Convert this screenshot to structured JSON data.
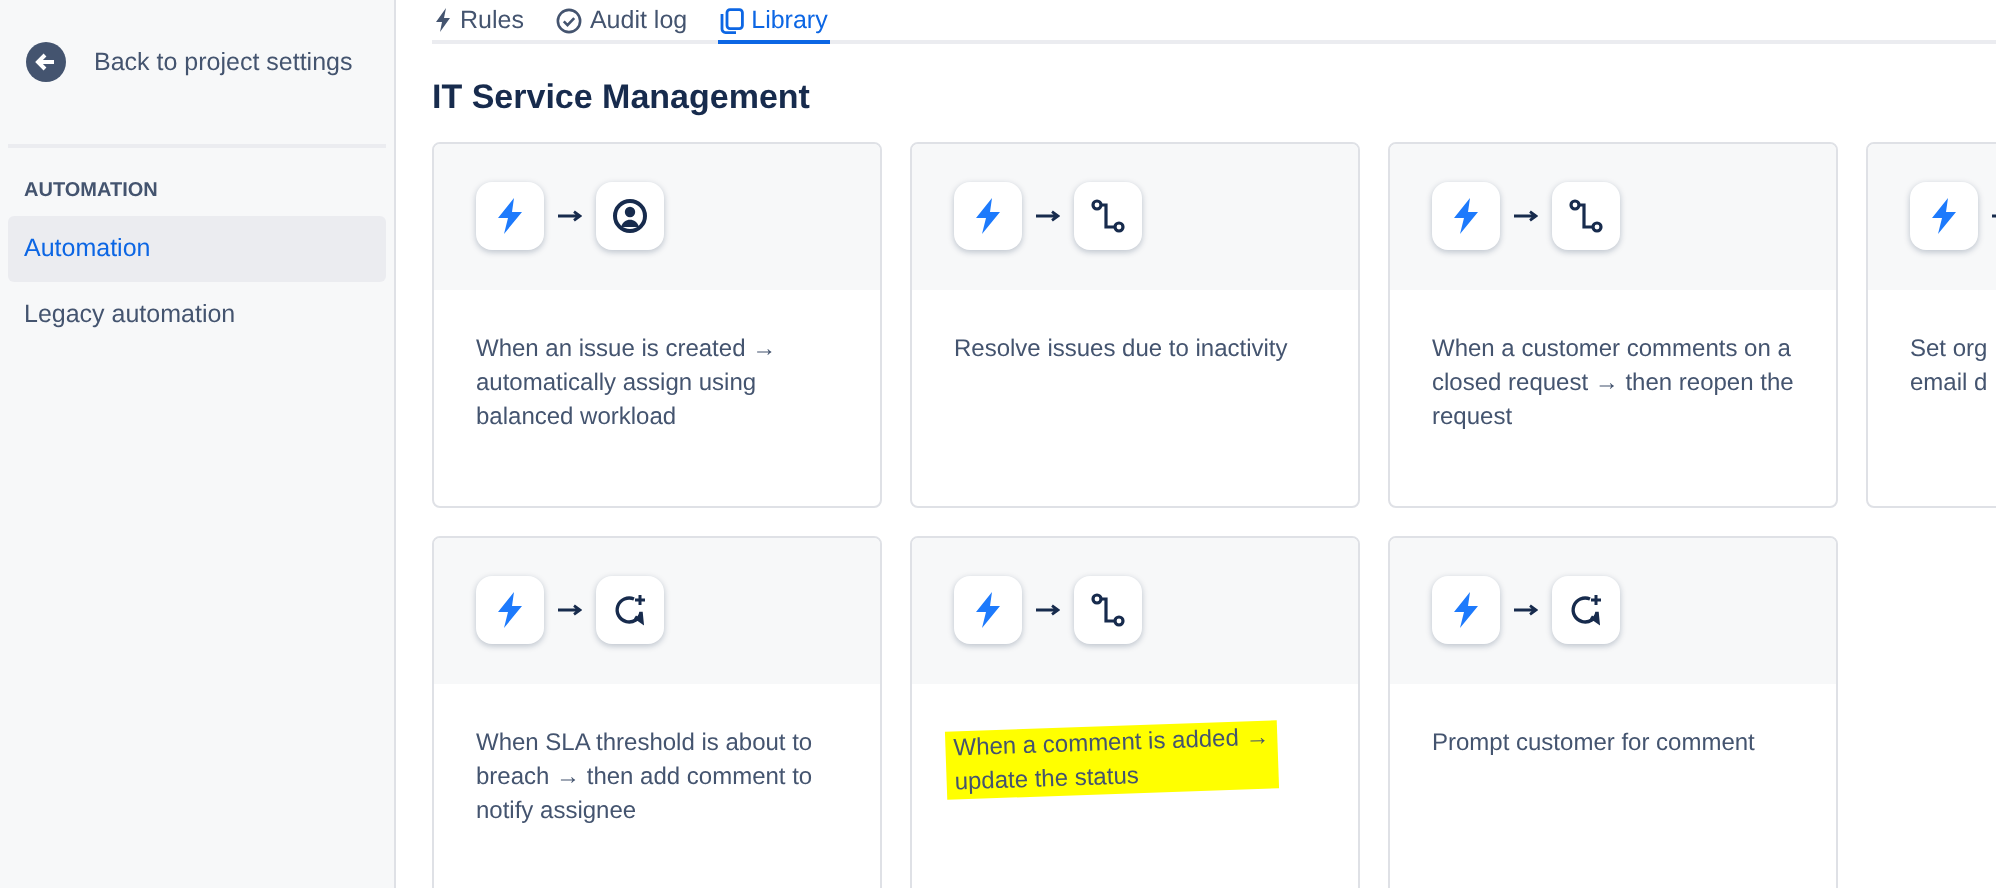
{
  "sidebar": {
    "back_link": "Back to project settings",
    "section_title": "AUTOMATION",
    "items": [
      {
        "label": "Automation",
        "selected": true
      },
      {
        "label": "Legacy automation",
        "selected": false
      }
    ]
  },
  "tabs": [
    {
      "label": "Rules",
      "kind": "bolt",
      "selected": false
    },
    {
      "label": "Audit log",
      "kind": "check",
      "selected": false
    },
    {
      "label": "Library",
      "kind": "copy",
      "selected": true
    }
  ],
  "heading": "IT Service Management",
  "cards": [
    {
      "kind": "person",
      "lines": [
        "When an issue is created →",
        "automatically assign using",
        "balanced workload"
      ],
      "highlighted": false
    },
    {
      "kind": "branch",
      "lines": [
        "Resolve issues due to inactivity"
      ],
      "highlighted": false
    },
    {
      "kind": "branch",
      "lines": [
        "When a customer comments on a",
        "closed request → then reopen the",
        "request"
      ],
      "highlighted": false
    },
    {
      "kind": "none",
      "lines": [
        "Set org",
        "email d"
      ],
      "highlighted": false
    },
    {
      "kind": "comment",
      "lines": [
        "When SLA threshold is about to",
        "breach → then add comment to",
        "notify assignee"
      ],
      "highlighted": false
    },
    {
      "kind": "branch",
      "lines": [
        "When a comment is added →",
        "update the status"
      ],
      "highlighted": true
    },
    {
      "kind": "comment",
      "lines": [
        "Prompt customer for comment"
      ],
      "highlighted": false
    }
  ]
}
